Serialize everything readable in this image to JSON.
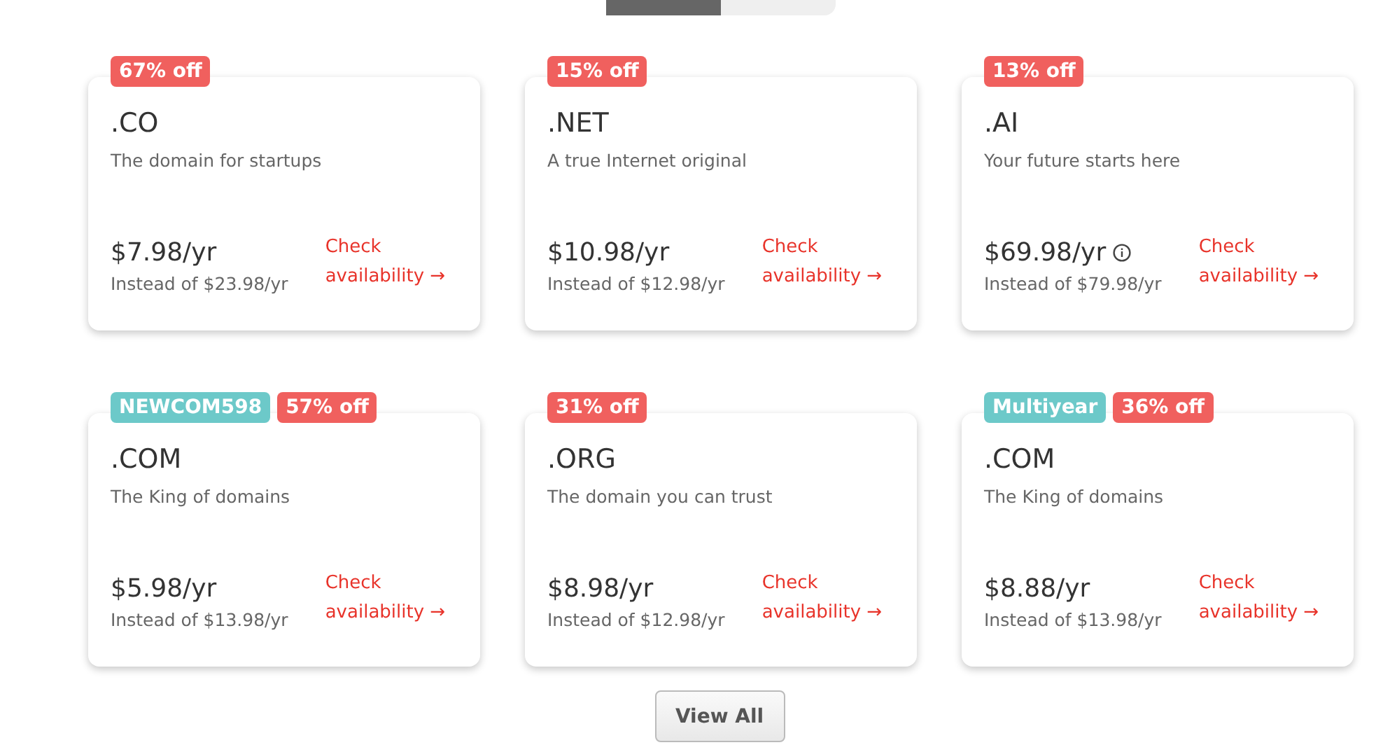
{
  "toggle": {
    "segments": [
      {
        "selected": true
      },
      {
        "selected": false
      }
    ]
  },
  "cards": [
    {
      "badges": [
        {
          "kind": "discount",
          "text": "67% off"
        }
      ],
      "domain": ".CO",
      "tagline": "The domain for startups",
      "price": "$7.98/yr",
      "info": false,
      "original": "Instead of $23.98/yr",
      "link": "Check availability →"
    },
    {
      "badges": [
        {
          "kind": "discount",
          "text": "15% off"
        }
      ],
      "domain": ".NET",
      "tagline": "A true Internet original",
      "price": "$10.98/yr",
      "info": false,
      "original": "Instead of $12.98/yr",
      "link": "Check availability →"
    },
    {
      "badges": [
        {
          "kind": "discount",
          "text": "13% off"
        }
      ],
      "domain": ".AI",
      "tagline": "Your future starts here",
      "price": "$69.98/yr",
      "info": true,
      "original": "Instead of $79.98/yr",
      "link": "Check availability →"
    },
    {
      "badges": [
        {
          "kind": "promo",
          "text": "NEWCOM598"
        },
        {
          "kind": "discount",
          "text": "57% off"
        }
      ],
      "domain": ".COM",
      "tagline": "The King of domains",
      "price": "$5.98/yr",
      "info": false,
      "original": "Instead of $13.98/yr",
      "link": "Check availability →"
    },
    {
      "badges": [
        {
          "kind": "discount",
          "text": "31% off"
        }
      ],
      "domain": ".ORG",
      "tagline": "The domain you can trust",
      "price": "$8.98/yr",
      "info": false,
      "original": "Instead of $12.98/yr",
      "link": "Check availability →"
    },
    {
      "badges": [
        {
          "kind": "promo",
          "text": "Multiyear"
        },
        {
          "kind": "discount",
          "text": "36% off"
        }
      ],
      "domain": ".COM",
      "tagline": "The King of domains",
      "price": "$8.88/yr",
      "info": false,
      "original": "Instead of $13.98/yr",
      "link": "Check availability →"
    }
  ],
  "button": "View All"
}
